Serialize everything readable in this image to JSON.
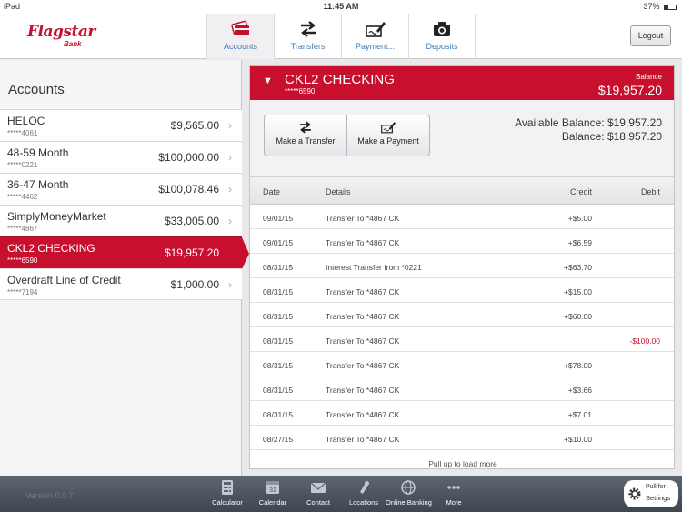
{
  "status_bar": {
    "device": "iPad",
    "time": "11:45 AM",
    "battery": "37%"
  },
  "logo": {
    "brand": "Flagstar",
    "sub": "Bank"
  },
  "nav": {
    "tabs": [
      {
        "label": "Accounts",
        "icon": "credit-cards-icon",
        "active": true
      },
      {
        "label": "Transfers",
        "icon": "transfer-arrows-icon"
      },
      {
        "label": "Payment...",
        "icon": "pen-paper-icon"
      },
      {
        "label": "Deposits",
        "icon": "camera-icon"
      }
    ],
    "logout": "Logout"
  },
  "accounts_panel": {
    "title": "Accounts",
    "accounts": [
      {
        "name": "HELOC",
        "number": "*****4061",
        "amount": "$9,565.00"
      },
      {
        "name": "48-59 Month",
        "number": "*****0221",
        "amount": "$100,000.00"
      },
      {
        "name": "36-47 Month",
        "number": "*****4462",
        "amount": "$100,078.46"
      },
      {
        "name": "SimplyMoneyMarket",
        "number": "*****4867",
        "amount": "$33,005.00"
      },
      {
        "name": "CKL2 CHECKING",
        "number": "*****6590",
        "amount": "$19,957.20",
        "selected": true
      },
      {
        "name": "Overdraft Line of Credit",
        "number": "*****7194",
        "amount": "$1,000.00"
      }
    ]
  },
  "detail": {
    "title": "CKL2 CHECKING",
    "number": "*****6590",
    "balance_label": "Balance",
    "balance": "$19,957.20",
    "make_transfer": "Make a Transfer",
    "make_payment": "Make a Payment",
    "available_balance": "Available Balance: $19,957.20",
    "balance_line": "Balance: $18,957.20",
    "columns": {
      "date": "Date",
      "details": "Details",
      "credit": "Credit",
      "debit": "Debit"
    },
    "transactions": [
      {
        "date": "09/01/15",
        "details": "Transfer To *4867 CK",
        "credit": "+$5.00",
        "debit": ""
      },
      {
        "date": "09/01/15",
        "details": "Transfer To *4867 CK",
        "credit": "+$6.59",
        "debit": ""
      },
      {
        "date": "08/31/15",
        "details": "Interest Transfer from *0221",
        "credit": "+$63.70",
        "debit": ""
      },
      {
        "date": "08/31/15",
        "details": "Transfer To *4867 CK",
        "credit": "+$15.00",
        "debit": ""
      },
      {
        "date": "08/31/15",
        "details": "Transfer To *4867 CK",
        "credit": "+$60.00",
        "debit": ""
      },
      {
        "date": "08/31/15",
        "details": "Transfer To *4867 CK",
        "credit": "",
        "debit": "-$100.00"
      },
      {
        "date": "08/31/15",
        "details": "Transfer To *4867 CK",
        "credit": "+$78.00",
        "debit": ""
      },
      {
        "date": "08/31/15",
        "details": "Transfer To *4867 CK",
        "credit": "+$3.66",
        "debit": ""
      },
      {
        "date": "08/31/15",
        "details": "Transfer To *4867 CK",
        "credit": "+$7.01",
        "debit": ""
      },
      {
        "date": "08/27/15",
        "details": "Transfer To *4867 CK",
        "credit": "+$10.00",
        "debit": ""
      }
    ],
    "load_more": "Pull up to load more"
  },
  "bottom_bar": {
    "version": "Version 0.0.7",
    "items": [
      {
        "label": "Calculator",
        "icon": "calculator-icon"
      },
      {
        "label": "Calendar",
        "icon": "calendar-icon",
        "glyph": "31"
      },
      {
        "label": "Contact",
        "icon": "envelope-icon"
      },
      {
        "label": "Locations",
        "icon": "location-pin-icon"
      },
      {
        "label": "Online Banking",
        "icon": "globe-icon"
      },
      {
        "label": "More",
        "icon": "more-dots-icon"
      }
    ],
    "settings_line1": "Pull for",
    "settings_line2": "Settings"
  },
  "colors": {
    "brand_red": "#c8102e",
    "link_blue": "#3d7ab8",
    "bottom_bar": "#4a525c"
  }
}
